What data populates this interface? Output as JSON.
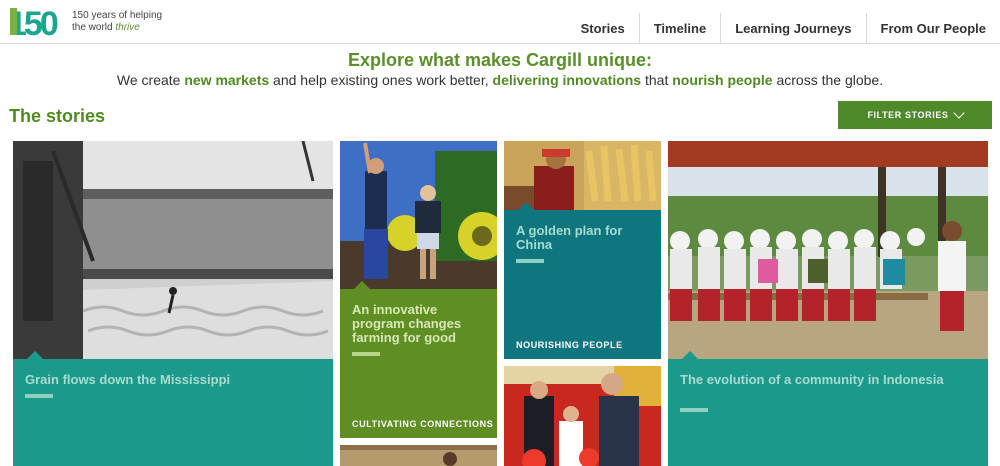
{
  "header": {
    "logo_number": "150",
    "tagline_line1": "150 years of helping",
    "tagline_line2_prefix": "the world ",
    "tagline_line2_emphasis": "thrive",
    "nav": [
      "Stories",
      "Timeline",
      "Learning Journeys",
      "From Our People"
    ]
  },
  "intro": {
    "title": "Explore what makes Cargill unique:",
    "sub_1": "We create ",
    "sub_hl_1": "new markets",
    "sub_2": " and help existing ones work better, ",
    "sub_hl_2": "delivering innovations",
    "sub_3": " that ",
    "sub_hl_3": "nourish people",
    "sub_4": " across the globe."
  },
  "stories": {
    "title": "The stories",
    "filter_label": "FILTER STORIES"
  },
  "cards": [
    {
      "title": "Grain flows down the Mississippi",
      "category": ""
    },
    {
      "title": "An innovative program changes farming for good",
      "category": "CULTIVATING CONNECTIONS"
    },
    {
      "title": "A golden plan for China",
      "category": "NOURISHING PEOPLE"
    },
    {
      "title": "The evolution of a community in Indonesia",
      "category": ""
    }
  ],
  "colors": {
    "brand_green": "#4f8a22",
    "teal": "#1b998b",
    "dark_teal": "#0f7680",
    "olive_green": "#5f8f22",
    "highlight_mint": "#a6dccf"
  },
  "icons": [
    "chevron-down-icon"
  ]
}
